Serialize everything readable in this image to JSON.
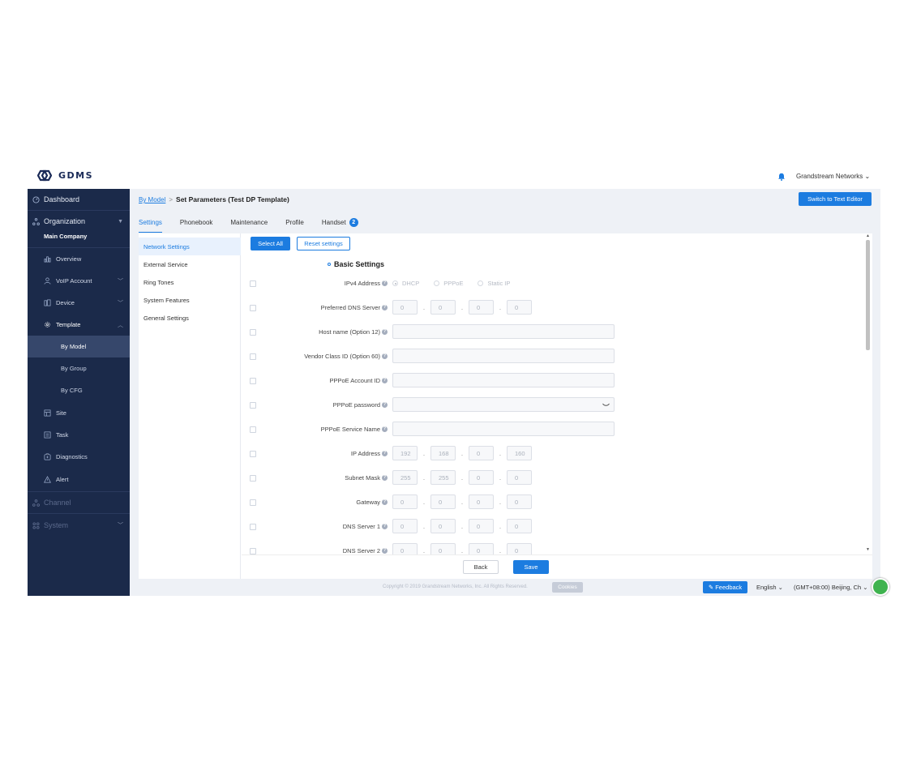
{
  "header": {
    "logo_text": "GDMS",
    "user": "Grandstream Networks ⌄"
  },
  "sidebar": {
    "dashboard": "Dashboard",
    "organization": "Organization",
    "company": "Main Company",
    "overview": "Overview",
    "voip": "VoIP Account",
    "device": "Device",
    "template": "Template",
    "by_model": "By Model",
    "by_group": "By Group",
    "by_cfg": "By CFG",
    "site": "Site",
    "task": "Task",
    "diagnostics": "Diagnostics",
    "alert": "Alert",
    "channel": "Channel",
    "system": "System"
  },
  "breadcrumb": {
    "link": "By Model",
    "sep": ">",
    "current": "Set Parameters (Test DP Template)"
  },
  "switch_button": "Switch to Text Editor",
  "tabs": {
    "settings": "Settings",
    "phonebook": "Phonebook",
    "maintenance": "Maintenance",
    "profile": "Profile",
    "handset": "Handset",
    "handset_badge": "2"
  },
  "left_nav": {
    "network": "Network Settings",
    "external": "External Service",
    "ringtones": "Ring Tones",
    "features": "System Features",
    "general": "General Settings"
  },
  "form": {
    "select_all": "Select All",
    "reset": "Reset settings",
    "section": "Basic Settings",
    "ipv4_label": "IPv4 Address",
    "dhcp": "DHCP",
    "pppoe": "PPPoE",
    "static_ip": "Static IP",
    "pref_dns_label": "Preferred DNS Server",
    "pref_dns": [
      "0",
      "0",
      "0",
      "0"
    ],
    "hostname_label": "Host name (Option 12)",
    "vendor_label": "Vendor Class ID (Option 60)",
    "pppoe_id_label": "PPPoE Account ID",
    "pppoe_pw_label": "PPPoE password",
    "pppoe_svc_label": "PPPoE Service Name",
    "ip_label": "IP Address",
    "ip": [
      "192",
      "168",
      "0",
      "160"
    ],
    "mask_label": "Subnet Mask",
    "mask": [
      "255",
      "255",
      "0",
      "0"
    ],
    "gw_label": "Gateway",
    "gw": [
      "0",
      "0",
      "0",
      "0"
    ],
    "dns1_label": "DNS Server 1",
    "dns1": [
      "0",
      "0",
      "0",
      "0"
    ],
    "dns2_label": "DNS Server 2",
    "dns2": [
      "0",
      "0",
      "0",
      "0"
    ],
    "help": "?"
  },
  "actions": {
    "back": "Back",
    "save": "Save"
  },
  "footer": {
    "copyright": "Copyright © 2019 Grandstream Networks, Inc. All Rights Reserved.",
    "cookies": "Cookies",
    "feedback": "Feedback",
    "language": "English ⌄",
    "timezone": "(GMT+08:00) Beijing, Ch ⌄"
  },
  "colors": {
    "accent": "#1c7ce0",
    "sidebar": "#1b2a4a"
  }
}
